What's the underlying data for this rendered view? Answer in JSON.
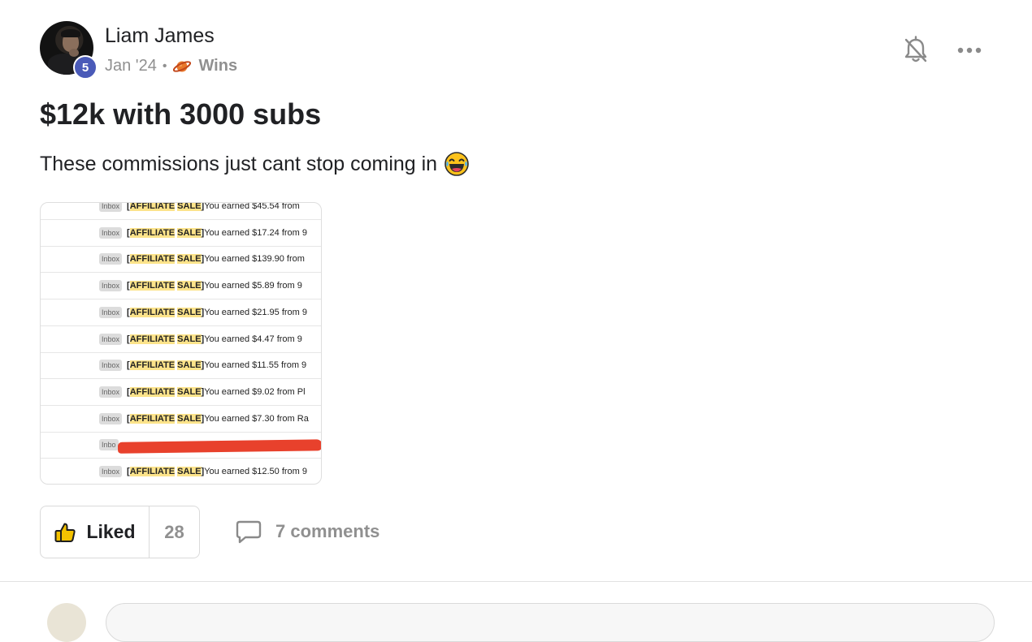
{
  "author": {
    "name": "Liam James",
    "level": "5"
  },
  "meta": {
    "date": "Jan '24",
    "separator": "•",
    "category_icon": "planet-icon",
    "category": "Wins"
  },
  "actions": {
    "bell_icon": "bell-off-icon",
    "more_icon": "more-icon"
  },
  "post": {
    "title": "$12k with 3000 subs",
    "body": "These commissions just cant stop coming in",
    "body_emoji": "laughing-tears-emoji"
  },
  "attachment": {
    "rows": [
      {
        "label": "Inbox",
        "tag_open": "[",
        "tag_a": "AFFILIATE",
        "tag_b": "SALE",
        "tag_close": "]",
        "text": "You earned $45.54 from"
      },
      {
        "label": "Inbox",
        "tag_open": "[",
        "tag_a": "AFFILIATE",
        "tag_b": "SALE",
        "tag_close": "]",
        "text": "You earned $17.24 from 9"
      },
      {
        "label": "Inbox",
        "tag_open": "[",
        "tag_a": "AFFILIATE",
        "tag_b": "SALE",
        "tag_close": "]",
        "text": "You earned $139.90 from"
      },
      {
        "label": "Inbox",
        "tag_open": "[",
        "tag_a": "AFFILIATE",
        "tag_b": "SALE",
        "tag_close": "]",
        "text": "You earned $5.89 from 9"
      },
      {
        "label": "Inbox",
        "tag_open": "[",
        "tag_a": "AFFILIATE",
        "tag_b": "SALE",
        "tag_close": "]",
        "text": "You earned $21.95 from 9"
      },
      {
        "label": "Inbox",
        "tag_open": "[",
        "tag_a": "AFFILIATE",
        "tag_b": "SALE",
        "tag_close": "]",
        "text": "You earned $4.47 from 9"
      },
      {
        "label": "Inbox",
        "tag_open": "[",
        "tag_a": "AFFILIATE",
        "tag_b": "SALE",
        "tag_close": "]",
        "text": "You earned $11.55 from 9"
      },
      {
        "label": "Inbox",
        "tag_open": "[",
        "tag_a": "AFFILIATE",
        "tag_b": "SALE",
        "tag_close": "]",
        "text": "You earned $9.02 from Pl"
      },
      {
        "label": "Inbox",
        "tag_open": "[",
        "tag_a": "AFFILIATE",
        "tag_b": "SALE",
        "tag_close": "]",
        "text": "You earned $7.30 from Ra"
      },
      {
        "label": "Inbo",
        "tag_open": "",
        "tag_a": "",
        "tag_b": "",
        "tag_close": "",
        "text": ""
      },
      {
        "label": "Inbox",
        "tag_open": "[",
        "tag_a": "AFFILIATE",
        "tag_b": "SALE",
        "tag_close": "]",
        "text": "You earned $12.50 from 9"
      }
    ]
  },
  "reactions": {
    "like_icon": "thumbs-up-icon",
    "like_label": "Liked",
    "like_count": "28",
    "comment_icon": "comment-icon",
    "comments_label": "7 comments"
  }
}
